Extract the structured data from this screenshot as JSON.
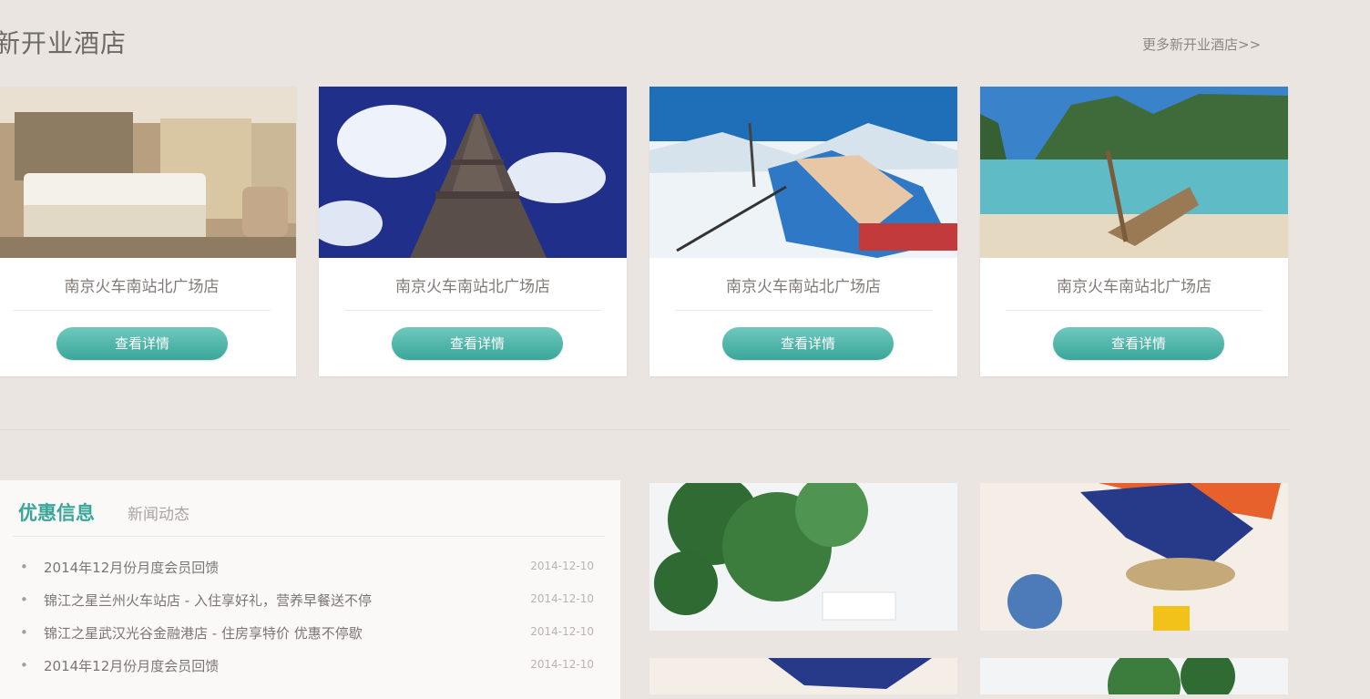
{
  "section": {
    "title": "新开业酒店",
    "more_link": "更多新开业酒店>>"
  },
  "hotels": [
    {
      "name": "南京火车南站北广场店",
      "button": "查看详情",
      "image": "hotel-room-image"
    },
    {
      "name": "南京火车南站北广场店",
      "button": "查看详情",
      "image": "eiffel-tower-image"
    },
    {
      "name": "南京火车南站北广场店",
      "button": "查看详情",
      "image": "skier-snow-image"
    },
    {
      "name": "南京火车南站北广场店",
      "button": "查看详情",
      "image": "tropical-beach-boat-image"
    }
  ],
  "news": {
    "tabs": [
      {
        "label": "优惠信息",
        "active": true
      },
      {
        "label": "新闻动态",
        "active": false
      }
    ],
    "items": [
      {
        "title": "2014年12月份月度会员回馈",
        "date": "2014-12-10"
      },
      {
        "title": "锦江之星兰州火车站店 - 入住享好礼，营养早餐送不停",
        "date": "2014-12-10"
      },
      {
        "title": "锦江之星武汉光谷金融港店 - 住房享特价 优惠不停歇",
        "date": "2014-12-10"
      },
      {
        "title": "2014年12月份月度会员回馈",
        "date": "2014-12-10"
      }
    ]
  },
  "colors": {
    "background": "#ebe5e1",
    "accent": "#3aa69a",
    "text": "#807b78"
  }
}
